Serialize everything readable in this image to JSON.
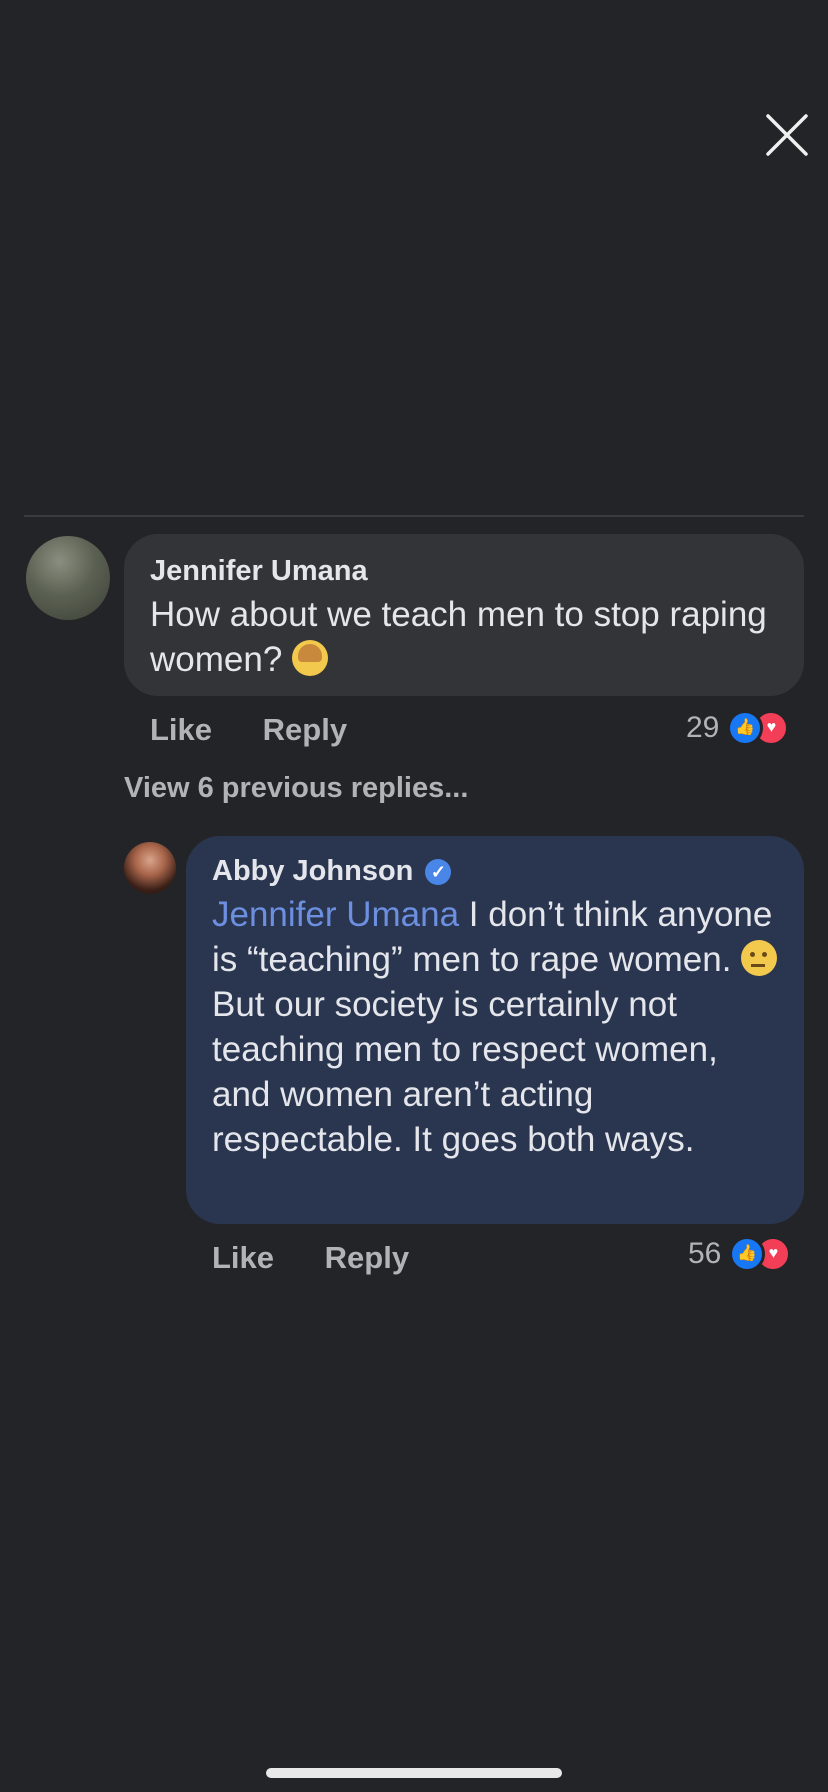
{
  "header": {
    "close_icon": "close-icon"
  },
  "comments": [
    {
      "author": "Jennifer Umana",
      "text": "How about we teach men to stop raping women?",
      "emoji": "person-shrugging-emoji",
      "actions": {
        "like": "Like",
        "reply": "Reply"
      },
      "reaction_count": "29",
      "reaction_icons": [
        "like-reaction-icon",
        "love-reaction-icon"
      ]
    }
  ],
  "view_previous": "View 6 previous replies...",
  "replies": [
    {
      "author": "Abby Johnson",
      "verified": true,
      "mention": "Jennifer Umana",
      "text_part1": " I don’t think anyone is “teaching” men to rape women. ",
      "emoji": "thinking-face-emoji",
      "text_part2": " But our society is certainly not teaching men to respect women, and women aren’t acting respectable. It goes both ways.",
      "actions": {
        "like": "Like",
        "reply": "Reply"
      },
      "reaction_count": "56",
      "reaction_icons": [
        "like-reaction-icon",
        "love-reaction-icon"
      ]
    }
  ],
  "colors": {
    "background": "#232427",
    "comment_bubble": "#333438",
    "reply_bubble": "#2a3650",
    "mention": "#6d8fe0",
    "like_blue": "#1877f2",
    "love_red": "#f33e58"
  }
}
